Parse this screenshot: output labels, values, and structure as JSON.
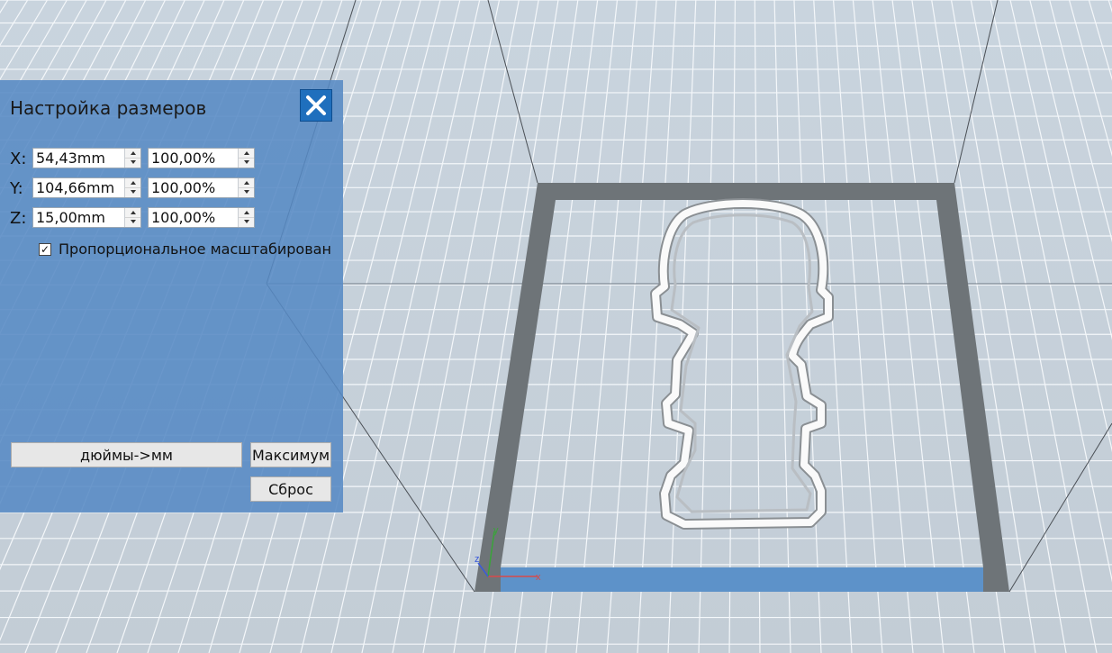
{
  "dialog": {
    "title": "Настройка размеров",
    "rows": [
      {
        "axis": "X:",
        "size": "54,43mm",
        "percent": "100,00%"
      },
      {
        "axis": "Y:",
        "size": "104,66mm",
        "percent": "100,00%"
      },
      {
        "axis": "Z:",
        "size": "15,00mm",
        "percent": "100,00%"
      }
    ],
    "proportional": {
      "label": "Пропорциональное масштабирование",
      "checked": true
    },
    "buttons": {
      "inches_to_mm": "дюймы->мм",
      "max": "Максимум",
      "reset": "Сброс"
    }
  },
  "axis_gizmo": {
    "x": "x",
    "y": "y",
    "z": "z"
  },
  "colors": {
    "panel": "#568ac4",
    "close_button": "#1f6fbd",
    "grid_background": "#c7d2dc",
    "build_border": "#6e7478",
    "gizmo_x": "#d84a4a",
    "gizmo_y": "#3aa43a",
    "gizmo_z": "#3a5adb"
  }
}
